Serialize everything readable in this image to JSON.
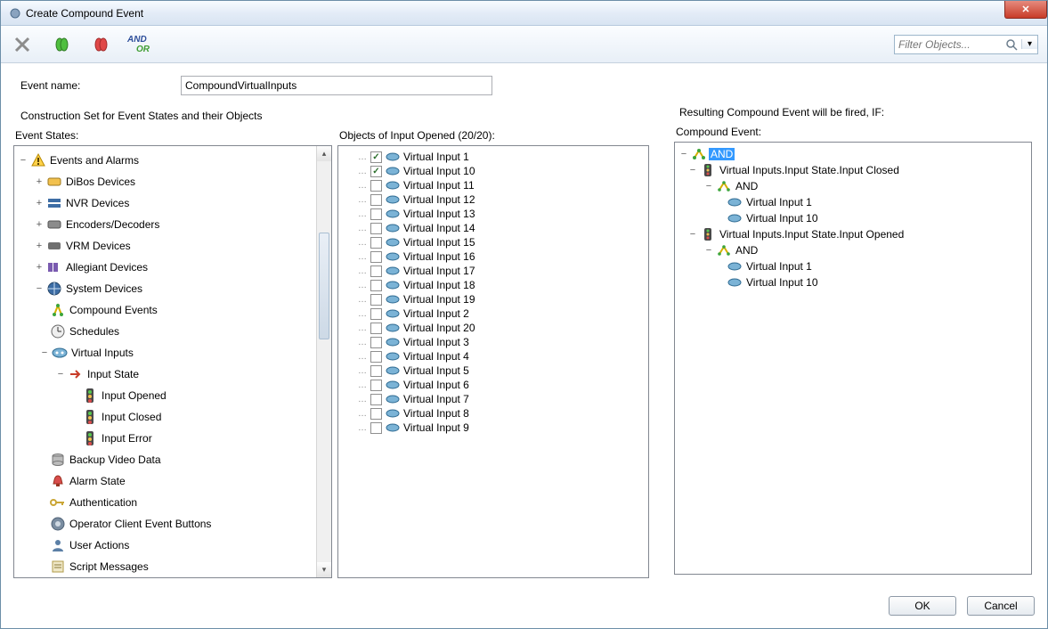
{
  "title": "Create Compound Event",
  "toolbar": {
    "filter_placeholder": "Filter Objects...",
    "andor_and": "AND",
    "andor_or": "OR"
  },
  "event_name": {
    "label": "Event name:",
    "value": "CompoundVirtualInputs"
  },
  "construction_label": "Construction Set for Event States and their Objects",
  "left": {
    "header": "Event States:",
    "root": "Events and Alarms",
    "nodes": {
      "dibos": "DiBos Devices",
      "nvr": "NVR Devices",
      "encdec": "Encoders/Decoders",
      "vrm": "VRM Devices",
      "allegiant": "Allegiant Devices",
      "system": "System Devices",
      "compound": "Compound Events",
      "schedules": "Schedules",
      "virtualinputs": "Virtual Inputs",
      "inputstate": "Input State",
      "inputopened": "Input Opened",
      "inputclosed": "Input Closed",
      "inputerror": "Input Error",
      "backup": "Backup Video Data",
      "alarmstate": "Alarm State",
      "auth": "Authentication",
      "opclient": "Operator Client Event Buttons",
      "useractions": "User Actions",
      "scriptmsg": "Script Messages"
    }
  },
  "mid": {
    "header": "Objects of Input Opened (20/20):",
    "items": [
      "Virtual Input 1",
      "Virtual Input 10",
      "Virtual Input 11",
      "Virtual Input 12",
      "Virtual Input 13",
      "Virtual Input 14",
      "Virtual Input 15",
      "Virtual Input 16",
      "Virtual Input 17",
      "Virtual Input 18",
      "Virtual Input 19",
      "Virtual Input 2",
      "Virtual Input 20",
      "Virtual Input 3",
      "Virtual Input 4",
      "Virtual Input 5",
      "Virtual Input 6",
      "Virtual Input 7",
      "Virtual Input 8",
      "Virtual Input 9"
    ]
  },
  "right": {
    "sentence": "Resulting Compound Event will be fired, IF:",
    "header": "Compound Event:",
    "root_and": "AND",
    "closed_path": "Virtual Inputs.Input State.Input Closed",
    "opened_path": "Virtual Inputs.Input State.Input Opened",
    "and_label": "AND",
    "vi1": "Virtual Input 1",
    "vi10": "Virtual Input 10"
  },
  "footer": {
    "ok": "OK",
    "cancel": "Cancel"
  },
  "icons": {
    "close_x": "✕",
    "plus": "+",
    "minus": "−",
    "tri_down": "▾",
    "tri_up": "▴",
    "check": "✓",
    "dot": "…"
  }
}
